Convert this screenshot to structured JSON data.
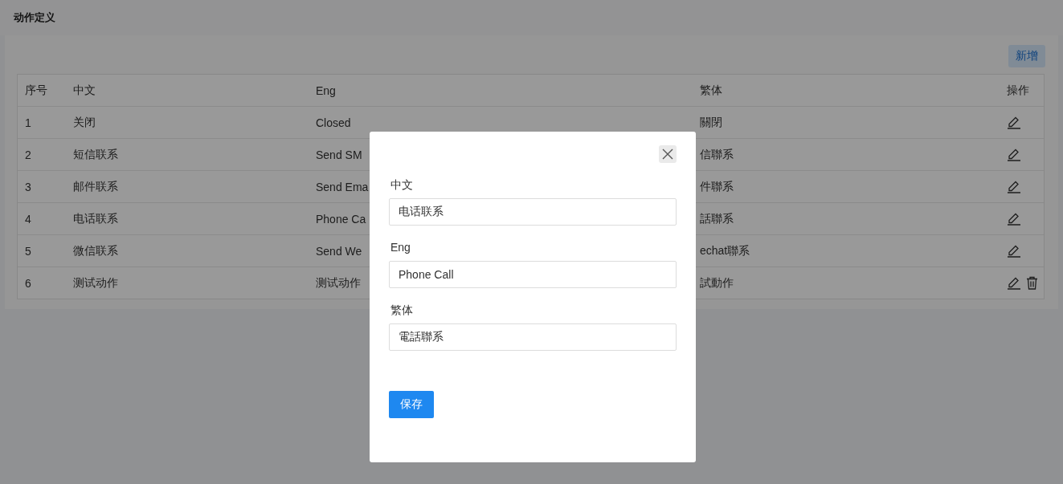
{
  "page_title": "动作定义",
  "add_button": "新增",
  "table": {
    "columns": [
      "序号",
      "中文",
      "Eng",
      "繁体",
      "操作"
    ],
    "rows": [
      {
        "no": "1",
        "zh": "关闭",
        "en": "Closed",
        "tc": "關閉",
        "deletable": false
      },
      {
        "no": "2",
        "zh": "短信联系",
        "en": "Send SM",
        "tc": "信聯系",
        "deletable": false
      },
      {
        "no": "3",
        "zh": "邮件联系",
        "en": "Send Ema",
        "tc": "件聯系",
        "deletable": false
      },
      {
        "no": "4",
        "zh": "电话联系",
        "en": "Phone Ca",
        "tc": "話聯系",
        "deletable": false
      },
      {
        "no": "5",
        "zh": "微信联系",
        "en": "Send We",
        "tc": "echat聯系",
        "deletable": false
      },
      {
        "no": "6",
        "zh": "测试动作",
        "en": "测试动作",
        "tc": "試動作",
        "deletable": true
      }
    ]
  },
  "dialog": {
    "fields": [
      {
        "label": "中文",
        "value": "电话联系"
      },
      {
        "label": "Eng",
        "value": "Phone Call"
      },
      {
        "label": "繁体",
        "value": "電話聯系"
      }
    ],
    "save_button": "保存"
  }
}
